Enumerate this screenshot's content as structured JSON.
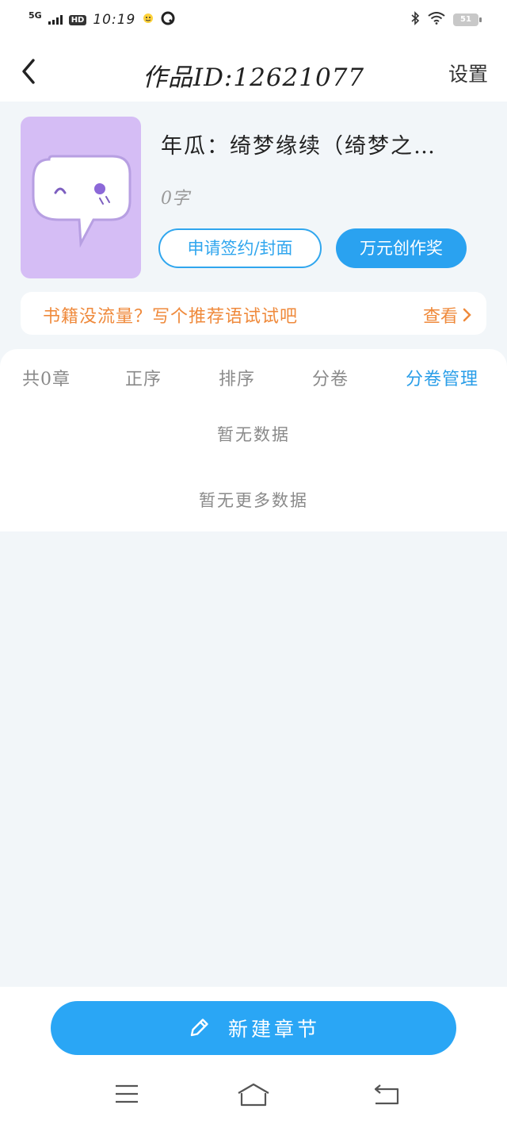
{
  "status_bar": {
    "network": "5G",
    "hd": "HD",
    "time": "10:19",
    "battery": "51"
  },
  "header": {
    "title": "作品ID:12621077",
    "settings_label": "设置"
  },
  "book": {
    "title": "年瓜：绮梦缘续（绮梦之…",
    "word_count": "0字",
    "sign_button": "申请签约/封面",
    "award_button": "万元创作奖"
  },
  "promo": {
    "text": "书籍没流量？写个推荐语试试吧",
    "link": "查看"
  },
  "chapters": {
    "tabs": [
      {
        "label": "共0章",
        "active": false
      },
      {
        "label": "正序",
        "active": false
      },
      {
        "label": "排序",
        "active": false
      },
      {
        "label": "分卷",
        "active": false
      },
      {
        "label": "分卷管理",
        "active": true
      }
    ],
    "empty_text": "暂无数据",
    "no_more_text": "暂无更多数据"
  },
  "bottom": {
    "new_chapter_label": "新建章节"
  },
  "colors": {
    "accent": "#2aa2f0",
    "promo": "#ef8a3c",
    "cover": "#d5bdf5",
    "background": "#f2f6f9"
  },
  "icons": [
    "back-arrow-icon",
    "pencil-icon",
    "chevron-right-icon",
    "menu-icon",
    "home-icon",
    "back-nav-icon",
    "wifi-icon",
    "bluetooth-icon"
  ]
}
